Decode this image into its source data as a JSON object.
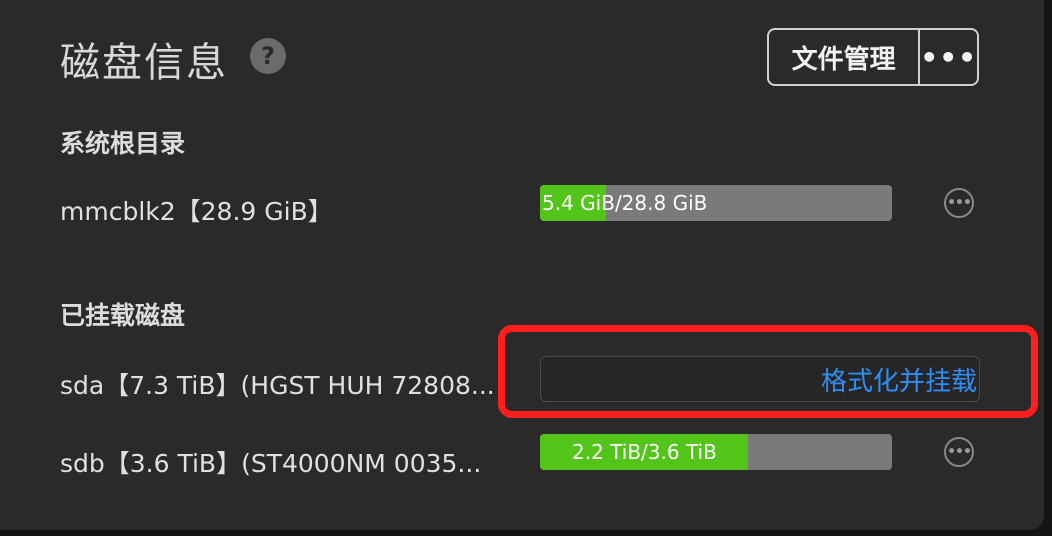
{
  "header": {
    "title": "磁盘信息",
    "help_icon": "?",
    "file_manage_button": "文件管理",
    "more_button": "•••"
  },
  "system_root": {
    "section_title": "系统根目录",
    "disk": {
      "label": "mmcblk2【28.9 GiB】",
      "usage_text": "5.4 GiB/28.8 GiB",
      "used_fraction": 0.1875
    }
  },
  "mounted": {
    "section_title": "已挂载磁盘",
    "disks": [
      {
        "label": "sda【7.3 TiB】(HGST HUH 72808...",
        "action": "格式化并挂载"
      },
      {
        "label": "sdb【3.6 TiB】(ST4000NM 0035...",
        "usage_text": "2.2 TiB/3.6 TiB",
        "used_fraction": 0.59
      }
    ]
  },
  "more_dots": "•••",
  "colors": {
    "accent": "#2f8ef5",
    "usage_fill": "#52c41a",
    "highlight": "#ff1f1f"
  }
}
